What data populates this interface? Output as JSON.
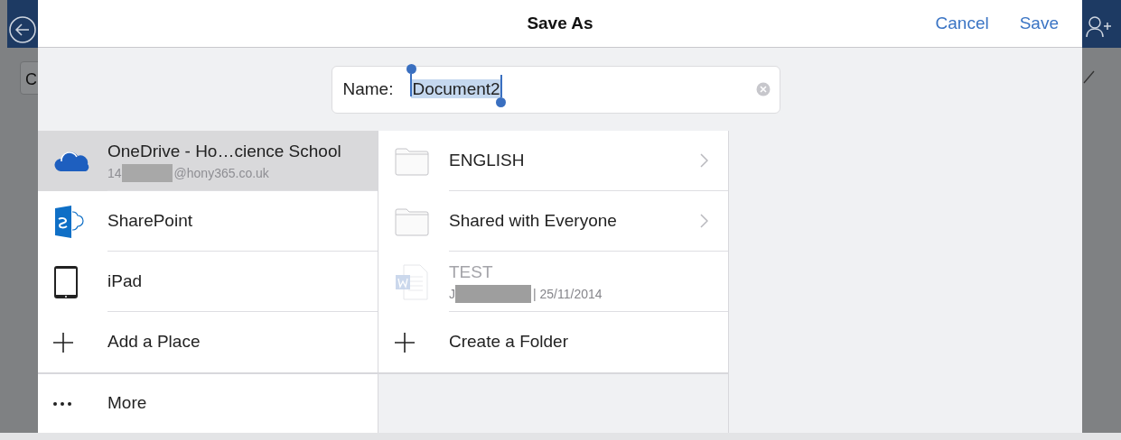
{
  "window": {
    "title": "Save As"
  },
  "header_buttons": [
    {
      "label": "Cancel"
    },
    {
      "label": "Save"
    }
  ],
  "background_app": {
    "field_text": "C"
  },
  "name_field": {
    "label": "Name:",
    "value": "Document2",
    "text_selected": true
  },
  "places": [
    {
      "kind": "onedrive",
      "title": "OneDrive - Ho…cience School",
      "subtitle_parts": [
        "14",
        "@hony365.co.uk"
      ],
      "selected": true
    },
    {
      "kind": "sharepoint",
      "title": "SharePoint",
      "selected": false
    },
    {
      "kind": "ipad",
      "title": "iPad",
      "selected": false
    },
    {
      "kind": "add",
      "title": "Add a Place",
      "selected": false
    },
    {
      "kind": "more",
      "title": "More",
      "selected": false
    }
  ],
  "folder_items": [
    {
      "kind": "folder",
      "title": "ENGLISH",
      "disabled": false
    },
    {
      "kind": "folder",
      "title": "Shared with Everyone",
      "disabled": false
    },
    {
      "kind": "document",
      "title": "TEST",
      "subtitle_parts": [
        "J",
        "| 25/11/2014"
      ],
      "disabled": true
    },
    {
      "kind": "create",
      "title": "Create a Folder",
      "disabled": false
    }
  ]
}
